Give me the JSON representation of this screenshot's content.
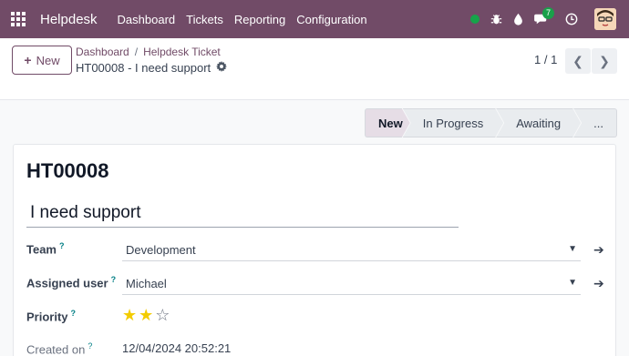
{
  "navbar": {
    "brand": "Helpdesk",
    "menu": [
      "Dashboard",
      "Tickets",
      "Reporting",
      "Configuration"
    ],
    "chat_count": "7",
    "colors": {
      "bg": "#714b67",
      "online": "#16a34a",
      "badge": "#1aa04a"
    },
    "icons": [
      "apps-grid-icon",
      "bug-icon",
      "drop-icon",
      "chat-icon",
      "clock-icon"
    ]
  },
  "control": {
    "new_label": "New",
    "breadcrumb": [
      "Dashboard",
      "Helpdesk Ticket"
    ],
    "record_title": "HT00008 - I need support",
    "pager": "1 / 1"
  },
  "statusbar": {
    "stages": [
      "New",
      "In Progress",
      "Awaiting",
      "..."
    ],
    "active": "New"
  },
  "form": {
    "reference": "HT00008",
    "subject": "I need support",
    "team": {
      "label": "Team",
      "value": "Development"
    },
    "assigned_user": {
      "label": "Assigned user",
      "value": "Michael"
    },
    "priority": {
      "label": "Priority",
      "value": 2,
      "max": 3
    },
    "created_on": {
      "label": "Created on",
      "value": "12/04/2024 20:52:21"
    },
    "help_mark": "?"
  }
}
